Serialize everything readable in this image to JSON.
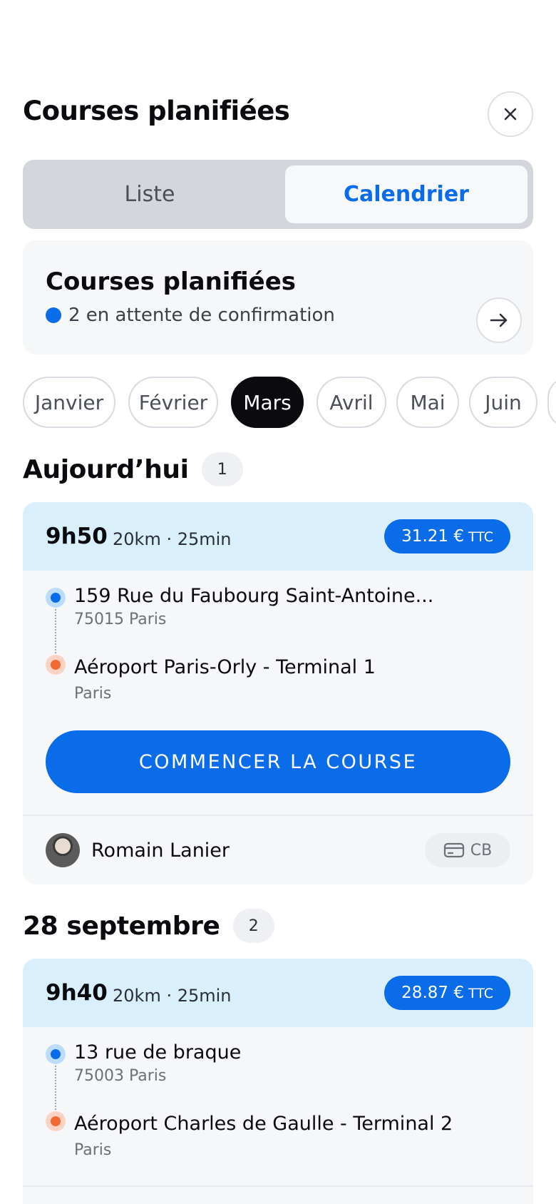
{
  "header": {
    "title": "Courses planifiées"
  },
  "segmented": {
    "left_label": "Liste",
    "right_label": "Calendrier"
  },
  "summary": {
    "title": "Courses planifiées",
    "subtitle": "2 en attente de confirmation"
  },
  "months": [
    "Janvier",
    "Février",
    "Mars",
    "Avril",
    "Mai",
    "Juin"
  ],
  "selected_month": "Mars",
  "sections": [
    {
      "title": "Aujourd’hui",
      "count": "1",
      "ride": {
        "time": "9h50",
        "meta": "20km · 25min",
        "price": "31.21 €",
        "price_suffix": "TTC",
        "pickup_address": "159 Rue du Faubourg Saint-Antoine...",
        "pickup_city": "75015 Paris",
        "dropoff_address": "Aéroport Paris-Orly - Terminal 1",
        "dropoff_city": "Paris",
        "action_label": "COMMENCER LA COURSE",
        "driver_name": "Romain Lanier",
        "payment": "CB"
      }
    },
    {
      "title": "28 septembre",
      "count": "2",
      "ride": {
        "time": "9h40",
        "meta": "20km · 25min",
        "price": "28.87 €",
        "price_suffix": "TTC",
        "pickup_address": "13 rue de braque",
        "pickup_city": "75003 Paris",
        "dropoff_address": "Aéroport Charles de Gaulle - Terminal 2",
        "dropoff_city": "Paris"
      }
    }
  ],
  "colors": {
    "accent": "#0a6ce8",
    "card_head": "#d9effc",
    "dropoff": "#f26a35"
  },
  "icons": {
    "close": "close-icon",
    "arrow": "arrow-right-icon",
    "card": "credit-card-icon"
  }
}
